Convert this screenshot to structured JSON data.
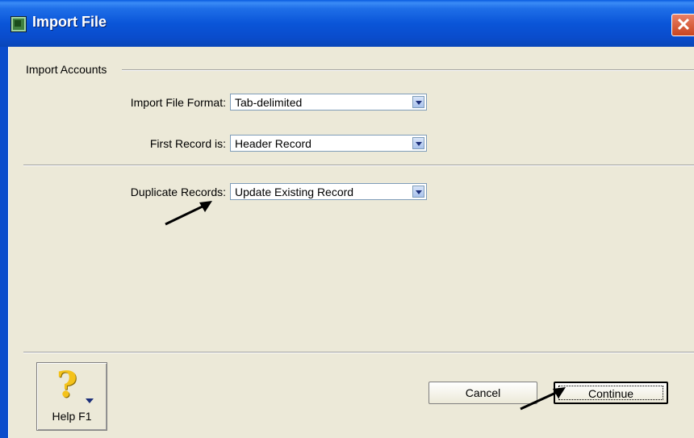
{
  "window": {
    "title": "Import File",
    "close_glyph": "✕"
  },
  "group": {
    "label": "Import Accounts"
  },
  "fields": [
    {
      "label": "Import File Format:",
      "value": "Tab-delimited"
    },
    {
      "label": "First Record is:",
      "value": "Header Record"
    },
    {
      "label": "Duplicate Records:",
      "value": "Update Existing Record"
    }
  ],
  "help": {
    "icon_glyph": "?",
    "label": "Help F1"
  },
  "buttons": {
    "cancel": "Cancel",
    "continue": "Continue"
  },
  "icons": {
    "window_icon": "app-icon",
    "close": "close-icon",
    "help": "question-mark-icon",
    "dropdown": "chevron-down-icon",
    "annotation": "arrow-icon"
  },
  "colors": {
    "titlebar": "#0a4ccc",
    "client_bg": "#ece9d8",
    "close_bg": "#c9451f"
  }
}
